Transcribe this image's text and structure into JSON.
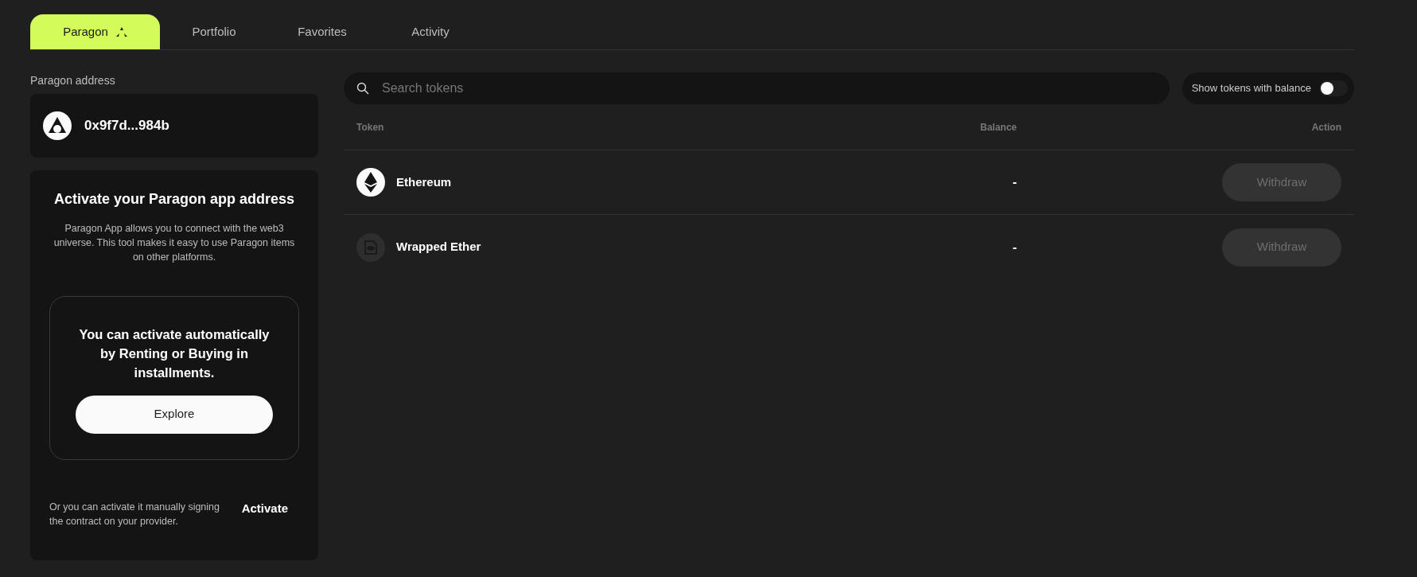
{
  "tabs": [
    {
      "label": "Paragon",
      "selected": true,
      "has_icon": true
    },
    {
      "label": "Portfolio",
      "selected": false,
      "has_icon": false
    },
    {
      "label": "Favorites",
      "selected": false,
      "has_icon": false
    },
    {
      "label": "Activity",
      "selected": false,
      "has_icon": false
    }
  ],
  "address_panel": {
    "label": "Paragon address",
    "address": "0x9f7d...984b"
  },
  "activate_card": {
    "title": "Activate your Paragon app address",
    "description": "Paragon App allows you to connect with the web3 universe. This tool makes it easy to use Paragon items on other platforms.",
    "promo_text": "You can activate automatically by Renting or Buying in installments.",
    "explore_button": "Explore",
    "manual_text": "Or you can activate it manually signing the contract on your provider.",
    "activate_link": "Activate"
  },
  "search": {
    "placeholder": "Search tokens"
  },
  "balance_toggle": {
    "label": "Show tokens with balance",
    "on": false
  },
  "table": {
    "columns": [
      "Token",
      "Balance",
      "Action"
    ],
    "rows": [
      {
        "kind": "eth",
        "name": "Ethereum",
        "balance": "-",
        "action": "Withdraw",
        "disabled": true
      },
      {
        "kind": "generic",
        "name": "Wrapped Ether",
        "balance": "-",
        "action": "Withdraw",
        "disabled": true
      }
    ]
  }
}
